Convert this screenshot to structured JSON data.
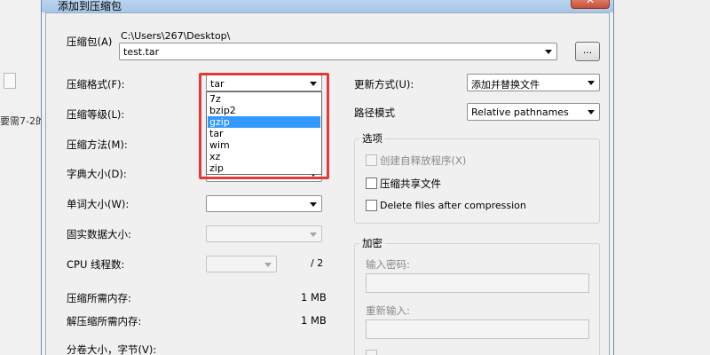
{
  "background": {
    "left_fragment_text": "要需7-2的"
  },
  "window": {
    "title": "添加到压缩包",
    "close_symbol": "✕"
  },
  "archive": {
    "label": "压缩包(A)",
    "path": "C:\\Users\\267\\Desktop\\",
    "filename": "test.tar",
    "browse_label": "..."
  },
  "fields": {
    "format": {
      "label": "压缩格式(F):",
      "value": "tar"
    },
    "level": {
      "label": "压缩等级(L):"
    },
    "method": {
      "label": "压缩方法(M):"
    },
    "dict": {
      "label": "字典大小(D):"
    },
    "word": {
      "label": "单词大小(W):"
    },
    "solid": {
      "label": "固实数据大小:"
    },
    "cpu": {
      "label": "CPU 线程数:",
      "suffix": "/ 2"
    },
    "mem_compress": {
      "label": "压缩所需内存:",
      "value": "1 MB"
    },
    "mem_decompress": {
      "label": "解压缩所需内存:",
      "value": "1 MB"
    },
    "volume": {
      "label": "分卷大小，字节(V):"
    }
  },
  "format_dropdown": {
    "options": [
      "7z",
      "bzip2",
      "gzip",
      "tar",
      "wim",
      "xz",
      "zip"
    ],
    "highlighted": "gzip"
  },
  "update": {
    "label": "更新方式(U):",
    "value": "添加并替换文件"
  },
  "pathmode": {
    "label": "路径模式",
    "value": "Relative pathnames"
  },
  "options": {
    "title": "选项",
    "sfx": "创建自释放程序(X)",
    "shared": "压缩共享文件",
    "delete": "Delete files after compression"
  },
  "encryption": {
    "title": "加密",
    "password_label": "输入密码:",
    "reenter_label": "重新输入:"
  },
  "colors": {
    "highlight_border": "#e53935",
    "selection": "#3399ff"
  }
}
